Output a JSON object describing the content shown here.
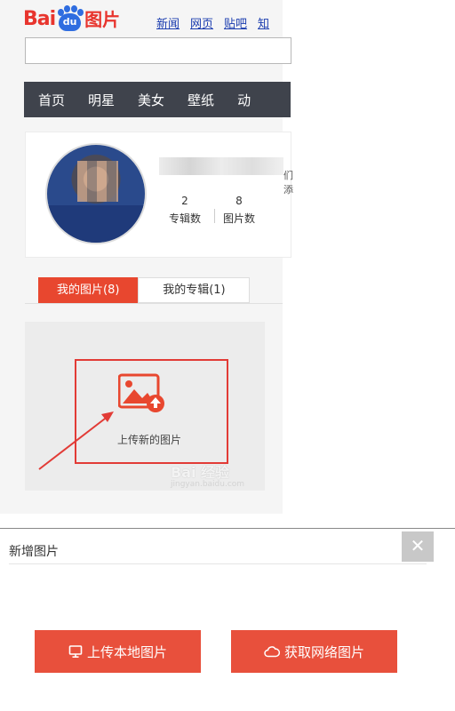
{
  "header": {
    "logo_text_bai": "Bai",
    "logo_text_du": "du",
    "logo_text_pics": "图片",
    "nav_links": [
      "新闻",
      "网页",
      "贴吧",
      "知"
    ]
  },
  "category_bar": {
    "items": [
      "首页",
      "明星",
      "美女",
      "壁纸",
      "动"
    ]
  },
  "profile": {
    "name_tail": "们添",
    "albums_count": "2",
    "albums_label": "专辑数",
    "photos_count": "8",
    "photos_label": "图片数"
  },
  "tabs": {
    "my_photos": "我的图片(8)",
    "my_albums": "我的专辑(1)"
  },
  "upload": {
    "label": "上传新的图片",
    "highlight_color": "#e23b36"
  },
  "watermark": {
    "brand": "Bai 经验",
    "url": "jingyan.baidu.com"
  },
  "dialog": {
    "title": "新增图片",
    "close_glyph": "✕",
    "upload_local": "上传本地图片",
    "fetch_network": "获取网络图片",
    "button_color": "#e8503c"
  },
  "icons": [
    "monitor-icon",
    "cloud-icon",
    "image-upload-icon",
    "close-icon"
  ]
}
